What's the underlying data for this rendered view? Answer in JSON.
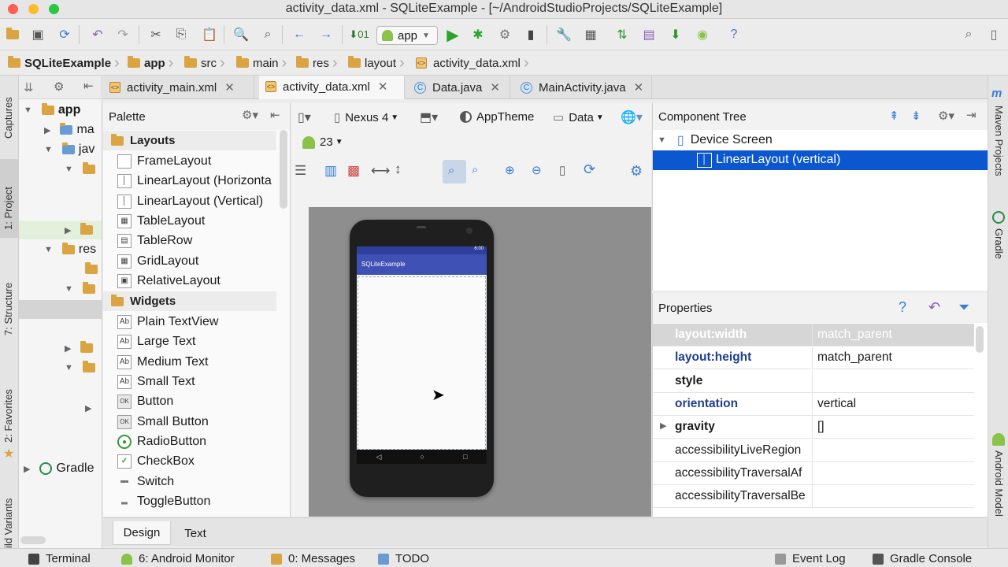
{
  "window": {
    "title": "activity_data.xml - SQLiteExample - [~/AndroidStudioProjects/SQLiteExample]",
    "traffic_colors": {
      "close": "#fc5f57",
      "minimize": "#fdbc2e",
      "maximize": "#28c840"
    }
  },
  "toolbar": {
    "run_config": "app"
  },
  "breadcrumb": [
    "SQLiteExample",
    "app",
    "src",
    "main",
    "res",
    "layout",
    "activity_data.xml"
  ],
  "left_tools": {
    "captures": "Captures",
    "project": "1: Project",
    "structure": "7: Structure",
    "favorites": "2: Favorites",
    "build_variants": "ild Variants"
  },
  "right_tools": {
    "maven": "Maven Projects",
    "gradle": "Gradle",
    "android_model": "Android Model"
  },
  "project_tree": [
    {
      "label": "app",
      "bold": true
    },
    {
      "label": "ma"
    },
    {
      "label": "jav"
    },
    {
      "label": ""
    },
    {
      "label": ""
    },
    {
      "label": "res"
    },
    {
      "label": ""
    },
    {
      "label": ""
    },
    {
      "label": ""
    },
    {
      "label": ""
    },
    {
      "label": ""
    },
    {
      "label": "Gradle"
    }
  ],
  "editor_tabs": [
    {
      "label": "activity_main.xml",
      "type": "xml",
      "active": false
    },
    {
      "label": "activity_data.xml",
      "type": "xml",
      "active": true
    },
    {
      "label": "Data.java",
      "type": "java",
      "active": false
    },
    {
      "label": "MainActivity.java",
      "type": "java",
      "active": false
    }
  ],
  "palette": {
    "title": "Palette",
    "groups": [
      {
        "name": "Layouts",
        "items": [
          "FrameLayout",
          "LinearLayout (Horizonta",
          "LinearLayout (Vertical)",
          "TableLayout",
          "TableRow",
          "GridLayout",
          "RelativeLayout"
        ]
      },
      {
        "name": "Widgets",
        "items": [
          "Plain TextView",
          "Large Text",
          "Medium Text",
          "Small Text",
          "Button",
          "Small Button",
          "RadioButton",
          "CheckBox",
          "Switch",
          "ToggleButton"
        ]
      }
    ]
  },
  "design_toolbar": {
    "device": "Nexus 4",
    "theme": "AppTheme",
    "activity": "Data",
    "api": "23"
  },
  "preview": {
    "app_title": "SQLiteExample",
    "status_time": "6:00",
    "accent": "#3f51b5"
  },
  "component_tree": {
    "title": "Component Tree",
    "root": "Device Screen",
    "selected": "LinearLayout (vertical)",
    "selection_color": "#0b57d0"
  },
  "properties": {
    "title": "Properties",
    "rows": [
      {
        "name": "layout:width",
        "value": "match_parent",
        "style": "header"
      },
      {
        "name": "layout:height",
        "value": "match_parent",
        "style": "blue"
      },
      {
        "name": "style",
        "value": "",
        "style": "bold"
      },
      {
        "name": "orientation",
        "value": "vertical",
        "style": "blue"
      },
      {
        "name": "gravity",
        "value": "[]",
        "style": "bold",
        "expandable": true
      },
      {
        "name": "accessibilityLiveRegion",
        "value": "",
        "style": "normal"
      },
      {
        "name": "accessibilityTraversalAf",
        "value": "",
        "style": "normal"
      },
      {
        "name": "accessibilityTraversalBe",
        "value": "",
        "style": "normal"
      }
    ]
  },
  "bottom_tabs": {
    "design": "Design",
    "text": "Text"
  },
  "status_bar": {
    "terminal": "Terminal",
    "android_monitor": "6: Android Monitor",
    "messages": "0: Messages",
    "todo": "TODO",
    "event_log": "Event Log",
    "gradle_console": "Gradle Console"
  }
}
